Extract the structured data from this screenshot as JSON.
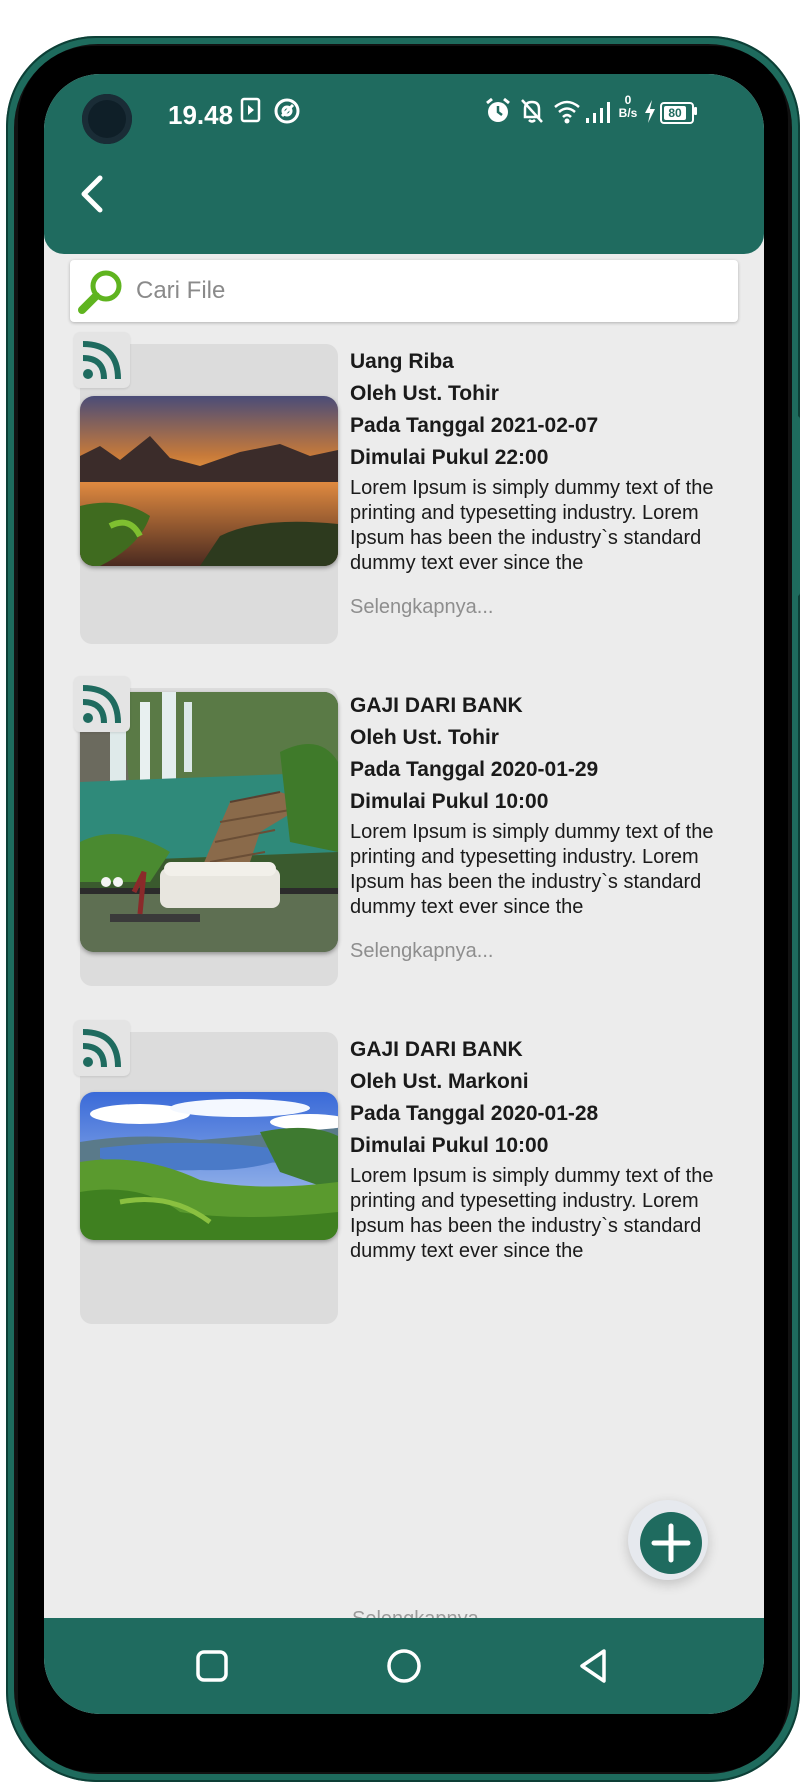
{
  "status_bar": {
    "time": "19.48",
    "net_speed_top": "0",
    "net_speed_unit": "B/s",
    "battery": "80"
  },
  "header": {
    "back_icon": "back-arrow-icon"
  },
  "search": {
    "placeholder": "Cari File",
    "value": ""
  },
  "posts": [
    {
      "title": "Uang Riba",
      "author": "Oleh Ust. Tohir",
      "date": "Pada Tanggal 2021-02-07",
      "start": "Dimulai Pukul 22:00",
      "desc": "Lorem Ipsum is simply dummy text of the printing and typesetting industry. Lorem Ipsum has been the industry`s standard dummy text ever since the",
      "more": "Selengkapnya...",
      "image": "sunset-lake-landscape"
    },
    {
      "title": "GAJI DARI BANK",
      "author": "Oleh Ust. Tohir",
      "date": "Pada Tanggal 2020-01-29",
      "start": "Dimulai Pukul 10:00",
      "desc": "Lorem Ipsum is simply dummy text of the printing and typesetting industry. Lorem Ipsum has been the industry`s standard dummy text ever since the",
      "more": "Selengkapnya...",
      "image": "waterfall-boardwalk-sofa"
    },
    {
      "title": "GAJI DARI BANK",
      "author": "Oleh Ust. Markoni",
      "date": "Pada Tanggal 2020-01-28",
      "start": "Dimulai Pukul 10:00",
      "desc": "Lorem Ipsum is simply dummy text of the printing and typesetting industry. Lorem Ipsum has been the industry`s standard dummy text ever since the",
      "more": "Selengkapnya...",
      "image": "lake-valley-landscape"
    }
  ],
  "fab": {
    "icon": "plus-icon"
  },
  "nav": {
    "icons": [
      "recents-square-icon",
      "home-circle-icon",
      "back-triangle-icon"
    ]
  },
  "colors": {
    "primary": "#1f6b5f",
    "background": "#ececec",
    "phone_frame": "#1e6b5d"
  }
}
